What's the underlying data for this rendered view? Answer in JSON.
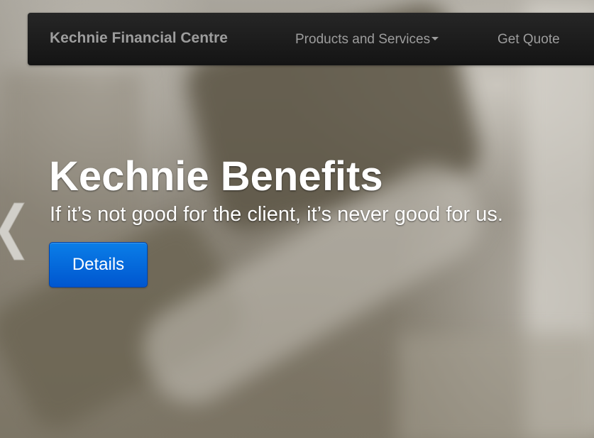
{
  "navbar": {
    "brand": "Kechnie Financial Centre",
    "items": [
      {
        "label": "Products and Services",
        "has_dropdown": true
      },
      {
        "label": "Get Quote",
        "has_dropdown": false
      }
    ]
  },
  "hero": {
    "title": "Kechnie Benefits",
    "tagline": "If it’s not good for the client, it’s never good for us.",
    "button_label": "Details"
  },
  "carousel": {
    "prev_icon": "chevron-left-icon"
  },
  "colors": {
    "navbar_bg": "#1b1b1b",
    "nav_text": "#9d9d9d",
    "button_primary": "#0068dd",
    "hero_text": "#ffffff"
  }
}
